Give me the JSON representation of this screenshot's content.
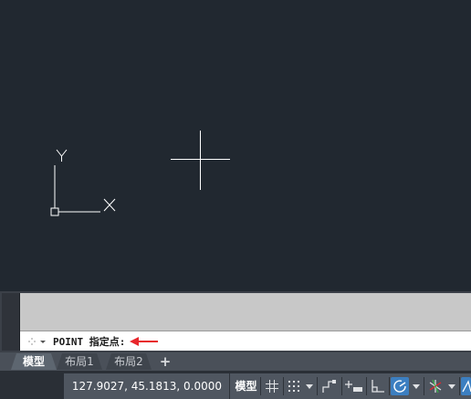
{
  "canvas": {
    "ucs_y_label": "Y",
    "ucs_x_label": "X",
    "background_color": "#212830",
    "crosshair_color": "#ffffff"
  },
  "command": {
    "text": "POINT 指定点:",
    "arrow_color": "#e8262b"
  },
  "tabs": {
    "items": [
      {
        "label": "模型",
        "active": true
      },
      {
        "label": "布局1",
        "active": false
      },
      {
        "label": "布局2",
        "active": false
      }
    ],
    "add_label": "+"
  },
  "status": {
    "coordinates": "127.9027, 45.1813, 0.0000",
    "model_label": "模型",
    "icons": [
      "grid-icon",
      "snap-icon",
      "dropdown-icon",
      "infer-constraints-icon",
      "dynamic-input-icon",
      "ortho-icon",
      "polar-tracking-icon",
      "isometric-icon",
      "object-snap-tracking-icon"
    ],
    "active_color": "#3c7fc1"
  }
}
